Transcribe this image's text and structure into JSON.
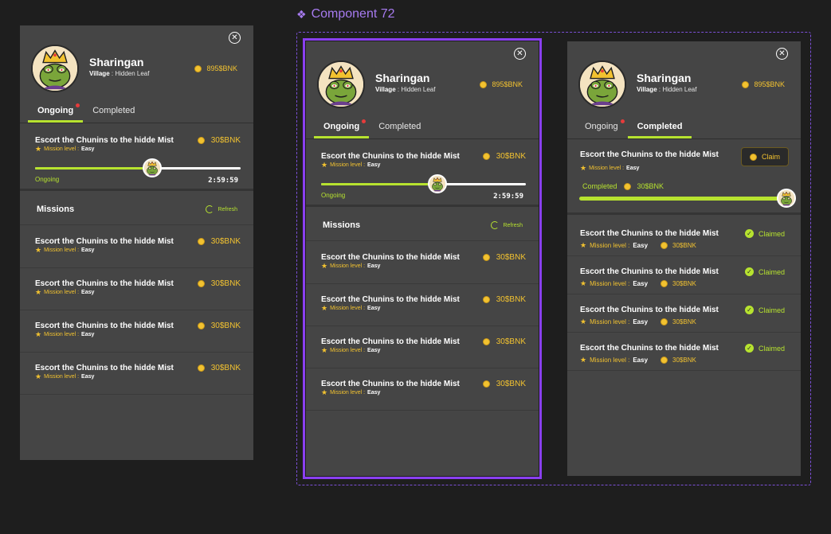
{
  "component": {
    "label": "Component 72",
    "icon": "component-diamond-icon"
  },
  "colors": {
    "accent": "#b7e32f",
    "coin": "#f2c230",
    "panel": "#454545",
    "selection": "#8a3ff0",
    "notification": "#e63b3b"
  },
  "user": {
    "name": "Sharingan",
    "village_label": "Village",
    "village_value": " : Hidden Leaf",
    "balance": "895$BNK",
    "avatar_icon": "frog-king-avatar-icon"
  },
  "tabs": {
    "ongoing": "Ongoing",
    "completed": "Completed"
  },
  "current_mission": {
    "title": "Escort the Chunins to the hidde Mist",
    "level_label": "Mission level : ",
    "level_value": "Easy",
    "reward": "30$BNK",
    "status": "Ongoing",
    "progress": 0.57,
    "timer": "2:59:59"
  },
  "completed_mission": {
    "title": "Escort the Chunins to the hidde Mist",
    "level_label": "Mission level : ",
    "level_value": "Easy",
    "claim_label": "Claim",
    "status": "Completed",
    "reward": "30$BNK",
    "progress": 1.0
  },
  "missions_section": {
    "title": "Missions",
    "refresh_label": "Refresh"
  },
  "missions": [
    {
      "title": "Escort the Chunins to the hidde Mist",
      "level_label": "Mission level : ",
      "level_value": "Easy",
      "reward": "30$BNK"
    },
    {
      "title": "Escort the Chunins to the hidde Mist",
      "level_label": "Mission level : ",
      "level_value": "Easy",
      "reward": "30$BNK"
    },
    {
      "title": "Escort the Chunins to the hidde Mist",
      "level_label": "Mission level : ",
      "level_value": "Easy",
      "reward": "30$BNK"
    },
    {
      "title": "Escort the Chunins to the hidde Mist",
      "level_label": "Mission level : ",
      "level_value": "Easy",
      "reward": "30$BNK"
    }
  ],
  "claimed_missions": [
    {
      "title": "Escort the Chunins to the hidde Mist",
      "level_label": "Mission level : ",
      "level_value": "Easy",
      "reward": "30$BNK",
      "status": "Claimed"
    },
    {
      "title": "Escort the Chunins to the hidde Mist",
      "level_label": "Mission level : ",
      "level_value": "Easy",
      "reward": "30$BNK",
      "status": "Claimed"
    },
    {
      "title": "Escort the Chunins to the hidde Mist",
      "level_label": "Mission level : ",
      "level_value": "Easy",
      "reward": "30$BNK",
      "status": "Claimed"
    },
    {
      "title": "Escort the Chunins to the hidde Mist",
      "level_label": "Mission level : ",
      "level_value": "Easy",
      "reward": "30$BNK",
      "status": "Claimed"
    }
  ]
}
